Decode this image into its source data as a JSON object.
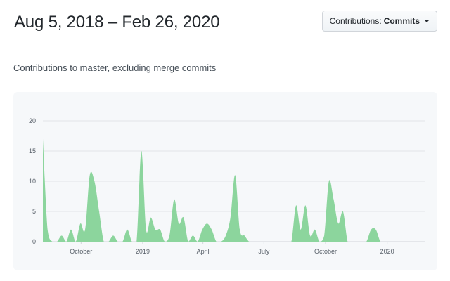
{
  "header": {
    "date_range": "Aug 5, 2018 – Feb 26, 2020",
    "contributions_select": {
      "label": "Contributions:",
      "value": "Commits"
    }
  },
  "subtitle": "Contributions to master, excluding merge commits",
  "chart_data": {
    "type": "area",
    "title": "",
    "xlabel": "",
    "ylabel": "",
    "ylim": [
      0,
      20
    ],
    "yticks": [
      0,
      5,
      10,
      15,
      20
    ],
    "grid": true,
    "fill_color": "#8cd59d",
    "line_color": "#28a745",
    "x_start": "2018-08-05",
    "x_end": "2020-02-26",
    "x_tick_labels": [
      {
        "label": "October",
        "date": "2018-10-01"
      },
      {
        "label": "2019",
        "date": "2019-01-01"
      },
      {
        "label": "April",
        "date": "2019-04-01"
      },
      {
        "label": "July",
        "date": "2019-07-01"
      },
      {
        "label": "October",
        "date": "2019-10-01"
      },
      {
        "label": "2020",
        "date": "2020-01-01"
      }
    ],
    "series": [
      {
        "name": "",
        "x": [
          "2018-08-05",
          "2018-08-12",
          "2018-08-19",
          "2018-08-26",
          "2018-09-02",
          "2018-09-09",
          "2018-09-16",
          "2018-09-23",
          "2018-09-30",
          "2018-10-07",
          "2018-10-14",
          "2018-10-21",
          "2018-10-28",
          "2018-11-04",
          "2018-11-11",
          "2018-11-18",
          "2018-11-25",
          "2018-12-02",
          "2018-12-09",
          "2018-12-16",
          "2018-12-23",
          "2018-12-30",
          "2019-01-06",
          "2019-01-13",
          "2019-01-20",
          "2019-01-27",
          "2019-02-03",
          "2019-02-10",
          "2019-02-17",
          "2019-02-24",
          "2019-03-03",
          "2019-03-10",
          "2019-03-17",
          "2019-03-24",
          "2019-03-31",
          "2019-04-07",
          "2019-04-14",
          "2019-04-21",
          "2019-04-28",
          "2019-05-05",
          "2019-05-12",
          "2019-05-19",
          "2019-05-26",
          "2019-06-02",
          "2019-06-09",
          "2019-06-16",
          "2019-06-23",
          "2019-06-30",
          "2019-07-07",
          "2019-07-14",
          "2019-07-21",
          "2019-07-28",
          "2019-08-04",
          "2019-08-11",
          "2019-08-18",
          "2019-08-25",
          "2019-09-01",
          "2019-09-08",
          "2019-09-15",
          "2019-09-22",
          "2019-09-29",
          "2019-10-06",
          "2019-10-13",
          "2019-10-20",
          "2019-10-27",
          "2019-11-03",
          "2019-11-10",
          "2019-11-17",
          "2019-11-24",
          "2019-12-01",
          "2019-12-08",
          "2019-12-15",
          "2019-12-22",
          "2019-12-29",
          "2020-01-05",
          "2020-01-12",
          "2020-01-19",
          "2020-01-26",
          "2020-02-02",
          "2020-02-09",
          "2020-02-16",
          "2020-02-23"
        ],
        "values": [
          17,
          2,
          0,
          0,
          1,
          0,
          2,
          0,
          3,
          2,
          11,
          10,
          5,
          0,
          0,
          1,
          0,
          0,
          2,
          0,
          0,
          15,
          2,
          4,
          2,
          2,
          0,
          1,
          7,
          3,
          4,
          0,
          1,
          0,
          2,
          3,
          2,
          0,
          0,
          1,
          4,
          11,
          2,
          1,
          0,
          0,
          0,
          0,
          0,
          0,
          0,
          0,
          0,
          0,
          6,
          2,
          6,
          1,
          2,
          0,
          1,
          10,
          7,
          3,
          5,
          0,
          0,
          0,
          0,
          0,
          2,
          2,
          0,
          0,
          0,
          0,
          0,
          0,
          0,
          0,
          0,
          0
        ]
      }
    ]
  }
}
